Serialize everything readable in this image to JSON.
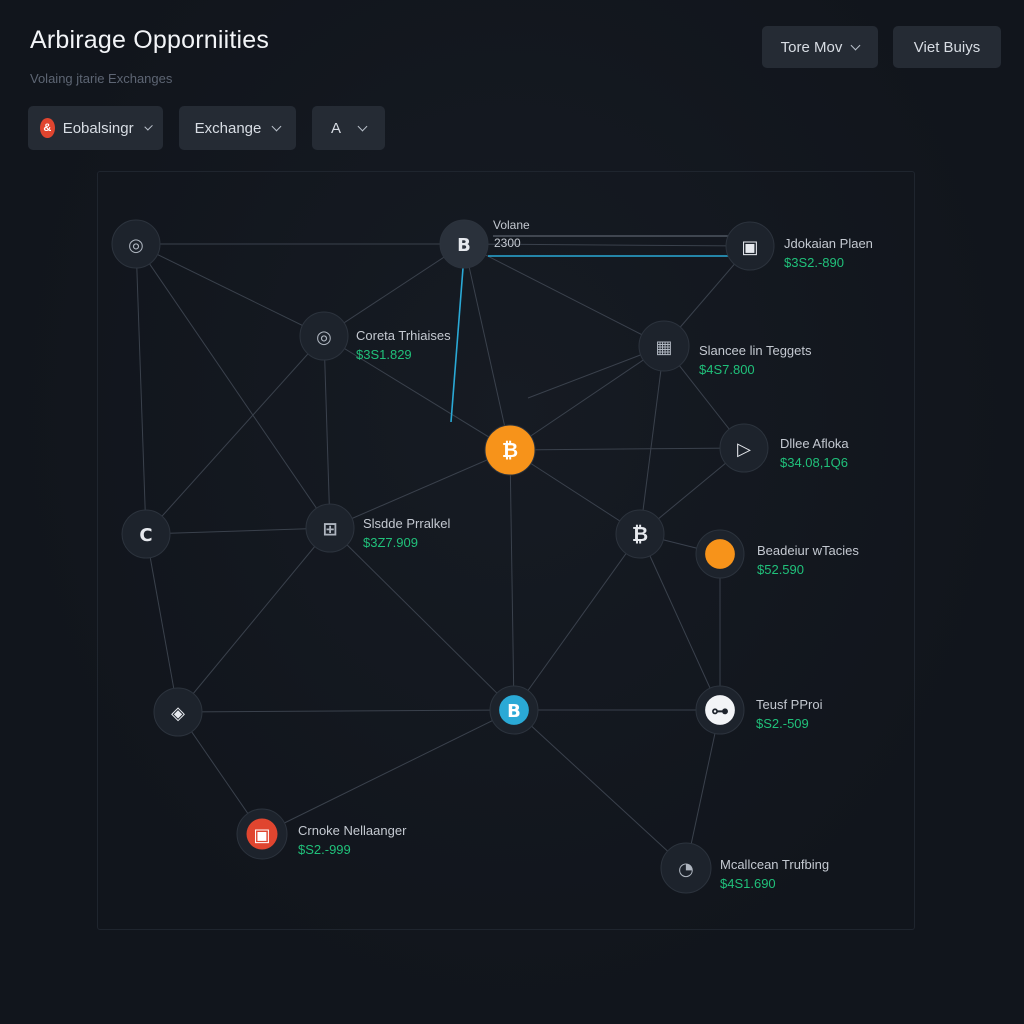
{
  "header": {
    "title": "Arbirage Opporniities",
    "subtitle": "Volaing jtarie Exchanges",
    "tore_button": "Tore Mov",
    "view_button": "Viet Buiys"
  },
  "filters": {
    "exchanges_label": "Eobalsingr",
    "exchange_label": "Exchange",
    "asset_label": "A"
  },
  "volume": {
    "label": "Volane",
    "value": "2300"
  },
  "nodes": [
    {
      "label": "",
      "price": ""
    },
    {
      "label": "",
      "price": ""
    },
    {
      "label": "Jdokaian Plaen",
      "price": "$3S2.-890"
    },
    {
      "label": "Coreta Trhiaises",
      "price": "$3S1.829"
    },
    {
      "label": "Slancee lin Teggets",
      "price": "$4S7.800"
    },
    {
      "label": "",
      "price": ""
    },
    {
      "label": "Dllee Afloka",
      "price": "$34.08,1Q6"
    },
    {
      "label": "",
      "price": ""
    },
    {
      "label": "Slsdde Prralkel",
      "price": "$3Z7.909"
    },
    {
      "label": "",
      "price": ""
    },
    {
      "label": "Beadeiur wTacies",
      "price": "$52.590"
    },
    {
      "label": "",
      "price": ""
    },
    {
      "label": "",
      "price": ""
    },
    {
      "label": "Teusf PProi",
      "price": "$S2.-509"
    },
    {
      "label": "Crnoke Nellaanger",
      "price": "$S2.-999"
    },
    {
      "label": "Mcallcean Trufbing",
      "price": "$4S1.690"
    }
  ],
  "colors": {
    "positive": "#20c07a",
    "bitcoin_orange": "#f7931a",
    "highlight_blue": "#2aa9d6",
    "alert_red": "#e0452f"
  }
}
